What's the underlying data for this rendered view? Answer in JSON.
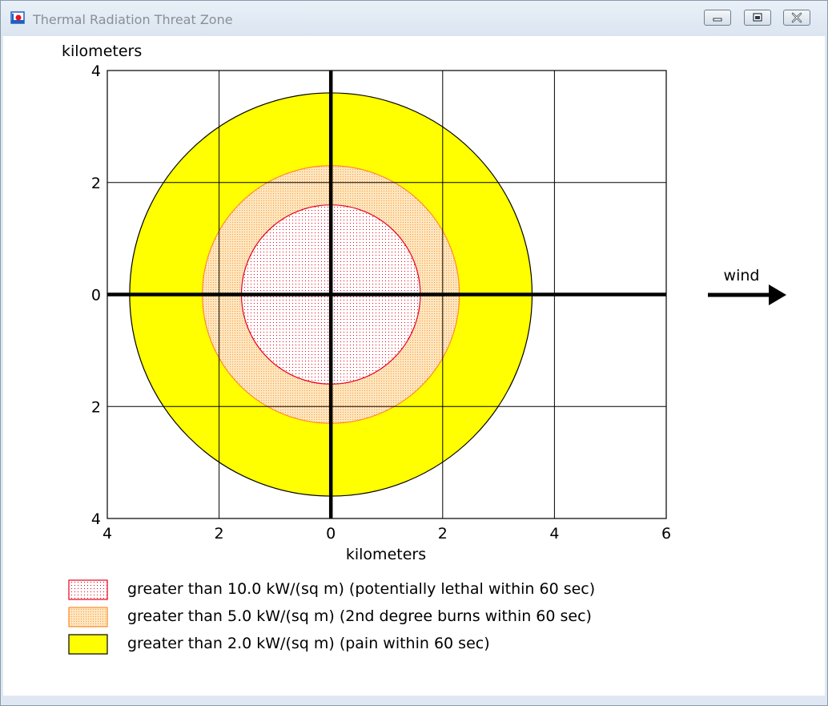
{
  "window": {
    "title": "Thermal Radiation Threat Zone",
    "controls": [
      "minimize",
      "restore",
      "close"
    ]
  },
  "plot": {
    "y_axis_label": "kilometers",
    "x_axis_label": "kilometers",
    "y_ticks": [
      {
        "value": 4,
        "label": "4"
      },
      {
        "value": 2,
        "label": "2"
      },
      {
        "value": 0,
        "label": "0"
      },
      {
        "value": -2,
        "label": "2"
      },
      {
        "value": -4,
        "label": "4"
      }
    ],
    "x_ticks": [
      {
        "value": -4,
        "label": "4"
      },
      {
        "value": -2,
        "label": "2"
      },
      {
        "value": 0,
        "label": "0"
      },
      {
        "value": 2,
        "label": "2"
      },
      {
        "value": 4,
        "label": "4"
      },
      {
        "value": 6,
        "label": "6"
      }
    ],
    "xlim": [
      -4,
      6
    ],
    "ylim": [
      -4,
      4
    ],
    "grid": true,
    "wind_label": "wind"
  },
  "zones": [
    {
      "radius_km": 3.6,
      "fill": "#ffff00",
      "stroke": "#000000",
      "pattern": "solid",
      "legend": "greater than 2.0 kW/(sq m) (pain within 60 sec)"
    },
    {
      "radius_km": 2.3,
      "fill": "#fde6c0",
      "stroke": "#ff8c2a",
      "pattern": "dots-orange",
      "legend": "greater than 5.0 kW/(sq m) (2nd degree burns within 60 sec)"
    },
    {
      "radius_km": 1.6,
      "fill": "#ffffff",
      "stroke": "#e8001c",
      "pattern": "dots-red",
      "legend": "greater than 10.0 kW/(sq m) (potentially lethal within 60 sec)"
    }
  ],
  "legend_order": [
    2,
    1,
    0
  ]
}
